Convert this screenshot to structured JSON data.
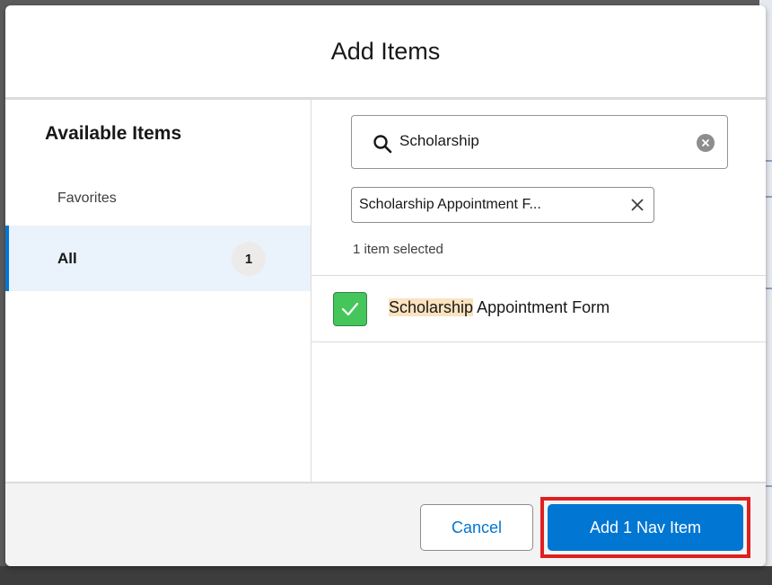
{
  "dialog": {
    "title": "Add Items"
  },
  "left_panel": {
    "heading": "Available Items",
    "nav": [
      {
        "label": "Favorites",
        "count": null,
        "selected": false
      },
      {
        "label": "All",
        "count": "1",
        "selected": true
      }
    ]
  },
  "search": {
    "value": "Scholarship",
    "icon": "search-icon",
    "clear_icon": "clear-icon"
  },
  "selected_pills": [
    {
      "label": "Scholarship Appointment F..."
    }
  ],
  "selection_status": "1 item selected",
  "results": [
    {
      "highlight": "Scholarship",
      "rest": " Appointment Form",
      "checked": true
    }
  ],
  "footer": {
    "cancel_label": "Cancel",
    "add_label": "Add 1 Nav Item"
  },
  "colors": {
    "brand": "#0176d3",
    "checkbox_checked": "#45c65a",
    "highlight": "#fbe3bf",
    "annotation": "#e02020"
  }
}
